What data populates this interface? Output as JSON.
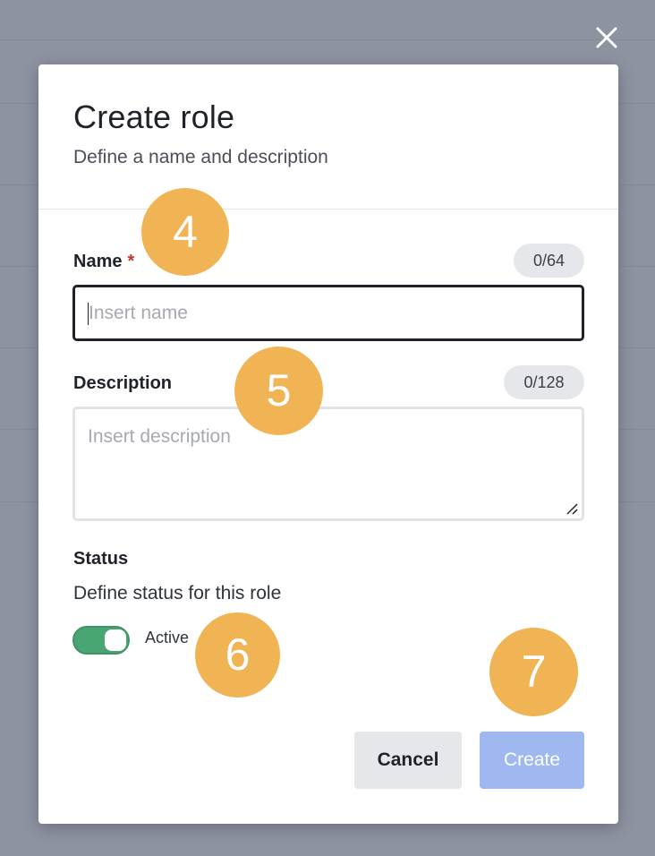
{
  "modal": {
    "title": "Create role",
    "subtitle": "Define a name and description",
    "close_icon": "close-icon"
  },
  "name_field": {
    "label": "Name",
    "required_mark": "*",
    "counter": "0/64",
    "placeholder": "Insert name",
    "value": ""
  },
  "description_field": {
    "label": "Description",
    "counter": "0/128",
    "placeholder": "Insert description",
    "value": ""
  },
  "status": {
    "label": "Status",
    "description": "Define status for this role",
    "toggle_label": "Active",
    "toggle_on": true
  },
  "actions": {
    "cancel_label": "Cancel",
    "create_label": "Create"
  },
  "step_badges": [
    "4",
    "5",
    "6",
    "7"
  ],
  "colors": {
    "accent_green": "#4aa574",
    "create_button_disabled": "#9fb9f0",
    "badge": "#f0b454",
    "required": "#c0392b"
  }
}
